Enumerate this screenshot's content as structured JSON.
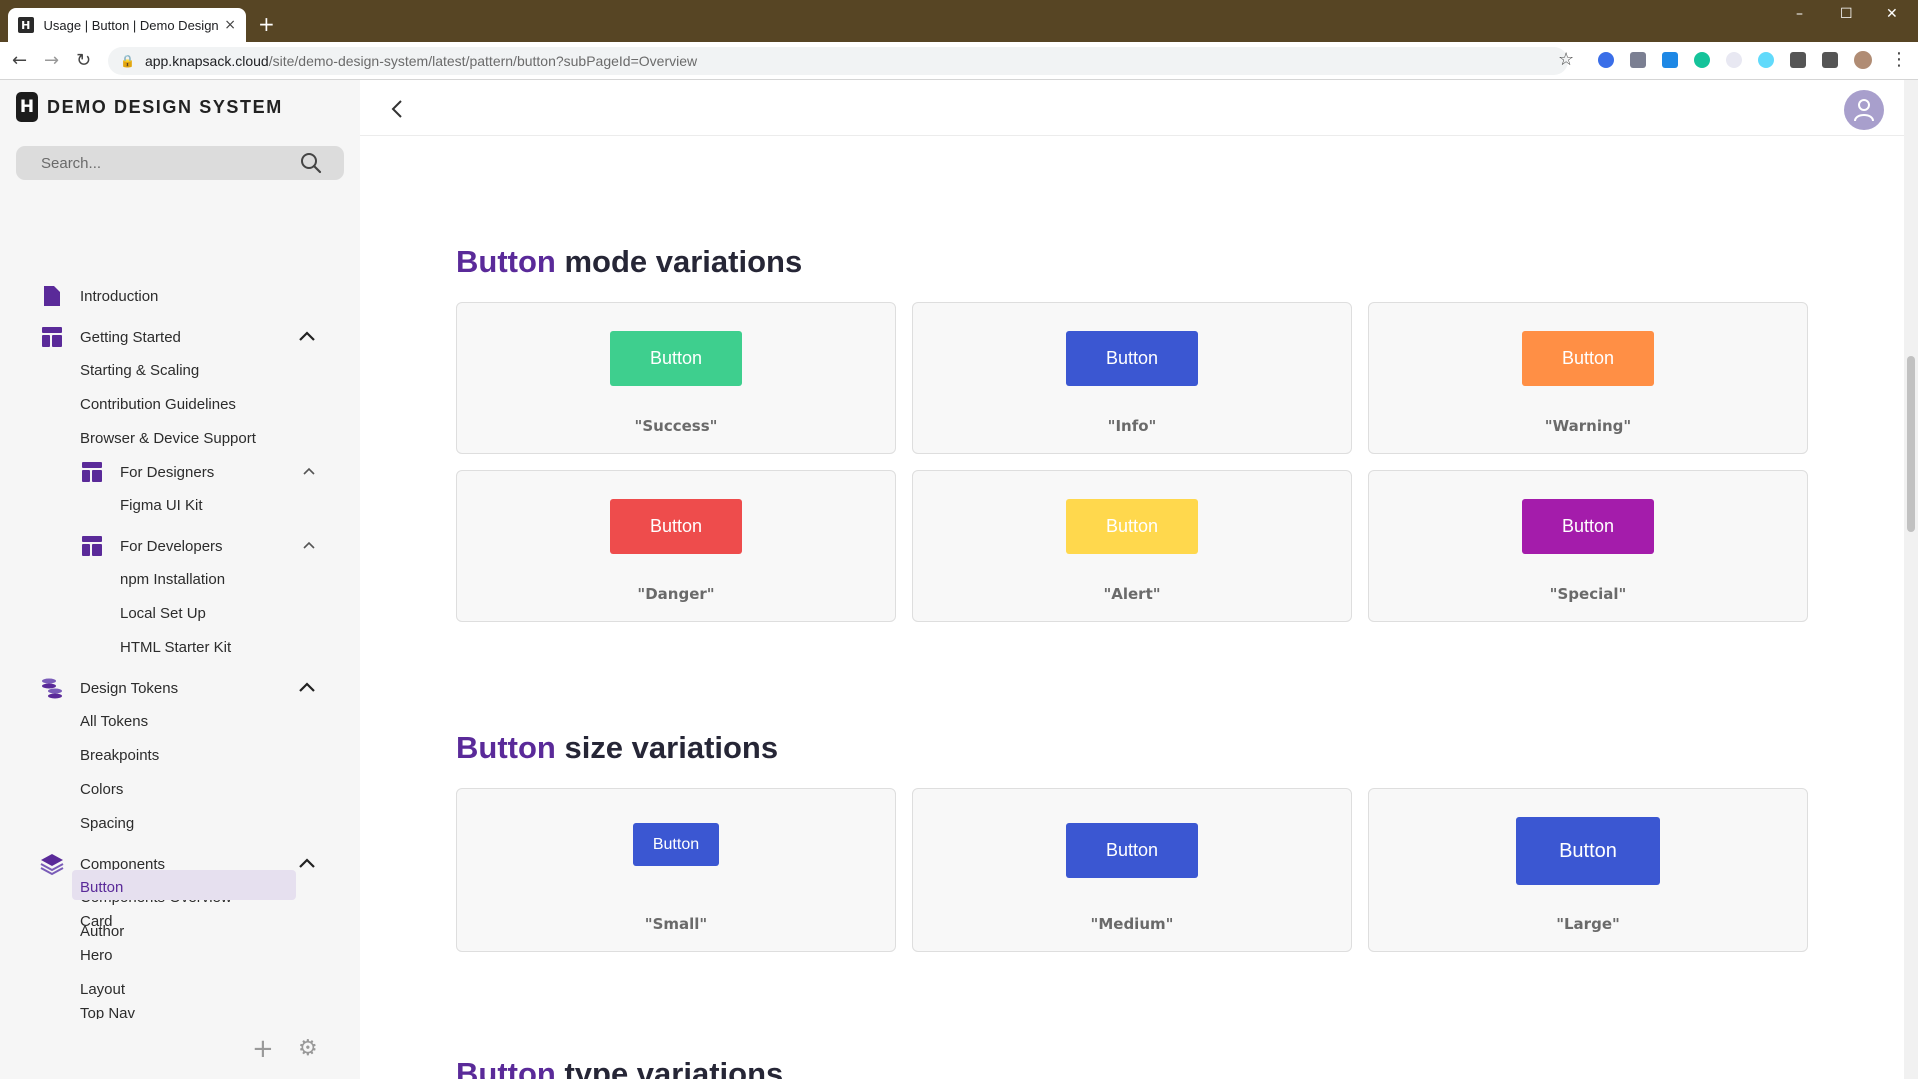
{
  "browser": {
    "tab_title": "Usage | Button | Demo Design Sy",
    "tab_favicon": "H",
    "tab_close": "×",
    "new_tab": "+",
    "url_host": "app.knapsack.cloud",
    "url_path": "/site/demo-design-system/latest/pattern/button?subPageId=Overview",
    "minimize": "–",
    "maximize": "☐",
    "close": "✕",
    "back": "←",
    "forward": "→",
    "reload": "↻",
    "lock": "🔒",
    "star": "☆",
    "menu": "⋮"
  },
  "sidebar": {
    "brand_logo": "H",
    "brand_name": "DEMO DESIGN SYSTEM",
    "search_placeholder": "Search...",
    "items": [
      {
        "label": "Introduction"
      },
      {
        "label": "Getting Started"
      },
      {
        "label": "Starting & Scaling"
      },
      {
        "label": "Contribution Guidelines"
      },
      {
        "label": "Browser & Device Support"
      },
      {
        "label": "For Designers"
      },
      {
        "label": "Figma UI Kit"
      },
      {
        "label": "For Developers"
      },
      {
        "label": "npm Installation"
      },
      {
        "label": "Local Set Up"
      },
      {
        "label": "HTML Starter Kit"
      },
      {
        "label": "Design Tokens"
      },
      {
        "label": "All Tokens"
      },
      {
        "label": "Breakpoints"
      },
      {
        "label": "Colors"
      },
      {
        "label": "Spacing"
      },
      {
        "label": "Components"
      },
      {
        "label": "Components Overview"
      },
      {
        "label": "Author"
      },
      {
        "label": "Button"
      },
      {
        "label": "Card"
      },
      {
        "label": "Hero"
      },
      {
        "label": "Layout"
      },
      {
        "label": "Top Nav"
      }
    ],
    "add": "+",
    "settings": "⚙"
  },
  "main": {
    "sections": [
      {
        "title_hl": "Button",
        "title_rest": " mode variations"
      },
      {
        "title_hl": "Button",
        "title_rest": " size variations"
      },
      {
        "title_hl": "Button",
        "title_rest": " type variations"
      }
    ],
    "mode_cards": [
      {
        "button_label": "Button",
        "caption": "\"Success\"",
        "color": "#3ecf8e"
      },
      {
        "button_label": "Button",
        "caption": "\"Info\"",
        "color": "#3b57d2"
      },
      {
        "button_label": "Button",
        "caption": "\"Warning\"",
        "color": "#ff8f45"
      },
      {
        "button_label": "Button",
        "caption": "\"Danger\"",
        "color": "#ee4c4c"
      },
      {
        "button_label": "Button",
        "caption": "\"Alert\"",
        "color": "#ffd84d"
      },
      {
        "button_label": "Button",
        "caption": "\"Special\"",
        "color": "#a41cab"
      }
    ],
    "size_cards": [
      {
        "button_label": "Button",
        "caption": "\"Small\"",
        "color": "#3b57d2"
      },
      {
        "button_label": "Button",
        "caption": "\"Medium\"",
        "color": "#3b57d2"
      },
      {
        "button_label": "Button",
        "caption": "\"Large\"",
        "color": "#3b57d2"
      }
    ]
  },
  "colors": {
    "accent": "#5a2a99",
    "titlebar": "#574524",
    "active_nav_bg": "#e6e0ef"
  }
}
